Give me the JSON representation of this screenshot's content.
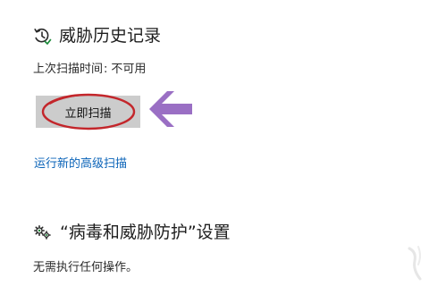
{
  "threat_history": {
    "title": "威胁历史记录",
    "icon": "history-clock-icon",
    "last_scan_label": "上次扫描时间",
    "last_scan_separator": ":",
    "last_scan_value": "不可用",
    "scan_now_label": "立即扫描",
    "advanced_scan_link": "运行新的高级扫描"
  },
  "virus_settings": {
    "title": "“病毒和威胁防护”设置",
    "icon": "gears-icon",
    "description": "无需执行任何操作。"
  },
  "annotation": {
    "highlight_color": "#c3262b",
    "arrow_color": "#9a6fc4"
  },
  "colors": {
    "link": "#0a63b8",
    "button_bg": "#cccccc",
    "text": "#1f1f1f",
    "background": "#ffffff"
  }
}
